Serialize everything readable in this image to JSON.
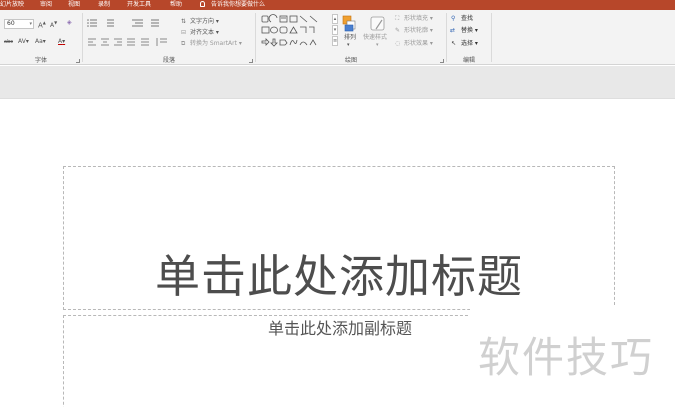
{
  "tabs": [
    "幻片放映",
    "审阅",
    "视图",
    "录制",
    "开发工具",
    "帮助"
  ],
  "tell_me": "告诉我你想要做什么",
  "ribbon": {
    "font": {
      "label": "字体",
      "size": "60",
      "grow": "A",
      "shrink": "A",
      "abc": "abc",
      "spacing": "AV",
      "case": "Aa",
      "color": "A"
    },
    "paragraph": {
      "label": "段落",
      "text_direction": "文字方向",
      "align_text": "对齐文本",
      "smartart": "转换为 SmartArt"
    },
    "drawing": {
      "label": "绘图",
      "arrange": "排列",
      "quick_styles": "快速样式",
      "shape_fill": "形状填充",
      "shape_outline": "形状轮廓",
      "shape_effects": "形状效果"
    },
    "editing": {
      "label": "编辑",
      "find": "查找",
      "replace": "替换",
      "select": "选择"
    }
  },
  "slide": {
    "title_placeholder": "单击此处添加标题",
    "subtitle_placeholder": "单击此处添加副标题"
  },
  "watermark": "软件技巧",
  "colors": {
    "tab_bar": "#b7472a",
    "ribbon_bg": "#f3f3f3",
    "band_bg": "#e8e8e8",
    "title_text": "#4d4d4d"
  }
}
